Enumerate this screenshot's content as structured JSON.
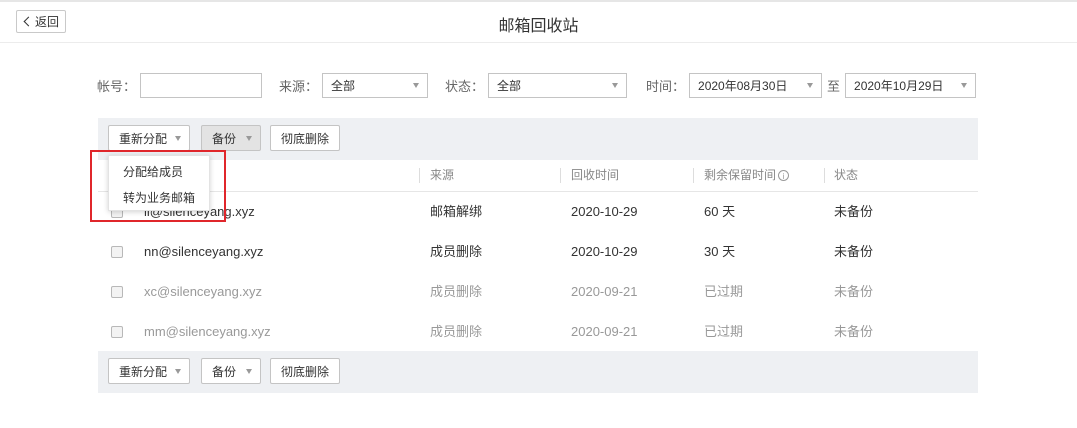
{
  "header": {
    "back_label": "返回",
    "title": "邮箱回收站"
  },
  "filters": {
    "account_label": "帐号：",
    "account_value": "",
    "source_label": "来源：",
    "source_value": "全部",
    "status_label": "状态：",
    "status_value": "全部",
    "time_label": "时间：",
    "date_from": "2020年08月30日",
    "to_label": "至",
    "date_to": "2020年10月29日"
  },
  "toolbar": {
    "reassign": "重新分配",
    "backup": "备份",
    "delete": "彻底删除"
  },
  "dropdown": {
    "items": [
      "分配给成员",
      "转为业务邮箱"
    ]
  },
  "columns": {
    "source": "来源",
    "recycle_time": "回收时间",
    "remaining": "剩余保留时间",
    "status": "状态"
  },
  "rows": [
    {
      "email": "ll@silenceyang.xyz",
      "source": "邮箱解绑",
      "time": "2020-10-29",
      "remaining": "60 天",
      "status": "未备份",
      "expired": false
    },
    {
      "email": "nn@silenceyang.xyz",
      "source": "成员删除",
      "time": "2020-10-29",
      "remaining": "30 天",
      "status": "未备份",
      "expired": false
    },
    {
      "email": "xc@silenceyang.xyz",
      "source": "成员删除",
      "time": "2020-09-21",
      "remaining": "已过期",
      "status": "未备份",
      "expired": true
    },
    {
      "email": "mm@silenceyang.xyz",
      "source": "成员删除",
      "time": "2020-09-21",
      "remaining": "已过期",
      "status": "未备份",
      "expired": true
    }
  ],
  "colors": {
    "highlight": "#e0262b",
    "toolbar_bg": "#eef0f3"
  }
}
